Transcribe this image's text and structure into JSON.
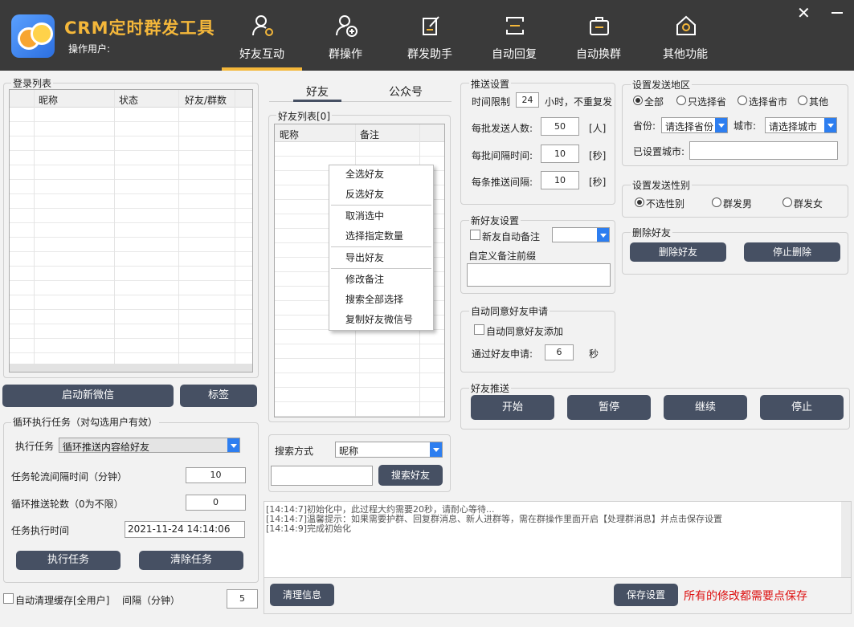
{
  "app": {
    "title": "CRM定时群发工具",
    "operator_label": "操作用户:",
    "accent_color": "#f4b73a",
    "header_color": "#3a3a3a"
  },
  "nav": [
    {
      "label": "好友互动",
      "icon": "user-gear-icon",
      "active": true
    },
    {
      "label": "群操作",
      "icon": "user-plus-icon",
      "active": false
    },
    {
      "label": "群发助手",
      "icon": "edit-doc-icon",
      "active": false
    },
    {
      "label": "自动回复",
      "icon": "auto-reply-icon",
      "active": false
    },
    {
      "label": "自动换群",
      "icon": "briefcase-icon",
      "active": false
    },
    {
      "label": "其他功能",
      "icon": "home-gear-icon",
      "active": false
    }
  ],
  "login_list": {
    "title": "登录列表",
    "columns": [
      "昵称",
      "状态",
      "好友/群数"
    ]
  },
  "left_buttons": {
    "start_wechat": "启动新微信",
    "tag": "标签"
  },
  "loop_task": {
    "title": "循环执行任务（对勾选用户有效）",
    "task_label": "执行任务",
    "task_value": "循环推送内容给好友",
    "interval_label": "任务轮流间隔时间（分钟）",
    "interval_value": "10",
    "rounds_label": "循环推送轮数（0为不限）",
    "rounds_value": "0",
    "time_label": "任务执行时间",
    "time_value": "2021-11-24 14:14:06",
    "exec_button": "执行任务",
    "clear_button": "清除任务"
  },
  "auto_clear": {
    "label": "自动清理缓存[全用户]",
    "interval_label": "间隔（分钟）",
    "interval_value": "5"
  },
  "tabs": {
    "friends": "好友",
    "public": "公众号"
  },
  "friend_list": {
    "title": "好友列表[0]",
    "columns": [
      "昵称",
      "备注"
    ]
  },
  "context_menu": [
    "全选好友",
    "反选好友",
    "取消选中",
    "选择指定数量",
    "导出好友",
    "修改备注",
    "搜索全部选择",
    "复制好友微信号"
  ],
  "search": {
    "label": "搜索方式",
    "mode": "昵称",
    "input_value": "",
    "button": "搜索好友"
  },
  "push_settings": {
    "title": "推送设置",
    "time_limit_label": "时间限制",
    "time_limit_value": "24",
    "time_limit_suffix": "小时，不重复发",
    "batch_label": "每批发送人数:",
    "batch_value": "50",
    "batch_unit": "[人]",
    "batch_interval_label": "每批间隔时间:",
    "batch_interval_value": "10",
    "batch_interval_unit": "[秒]",
    "each_interval_label": "每条推送间隔:",
    "each_interval_value": "10",
    "each_interval_unit": "[秒]"
  },
  "new_friend": {
    "title": "新好友设置",
    "auto_remark_label": "新友自动备注",
    "prefix_label": "自定义备注前缀",
    "prefix_value": ""
  },
  "auto_accept": {
    "title": "自动同意好友申请",
    "checkbox_label": "自动同意好友添加",
    "pass_label": "通过好友申请:",
    "pass_value": "6",
    "pass_unit": "秒"
  },
  "region": {
    "title": "设置发送地区",
    "options": [
      "全部",
      "只选择省",
      "选择省市",
      "其他"
    ],
    "selected": 0,
    "province_label": "省份:",
    "province_value": "请选择省份",
    "city_label": "城市:",
    "city_value": "请选择城市",
    "set_city_label": "已设置城市:",
    "set_city_value": ""
  },
  "gender": {
    "title": "设置发送性别",
    "options": [
      "不选性别",
      "群发男",
      "群发女"
    ],
    "selected": 0
  },
  "delete_friend": {
    "title": "删除好友",
    "delete_button": "删除好友",
    "stop_button": "停止删除"
  },
  "friend_push": {
    "title": "好友推送",
    "buttons": [
      "开始",
      "暂停",
      "继续",
      "停止"
    ]
  },
  "log": [
    "[14:14:7]初始化中，此过程大约需要20秒，请耐心等待...",
    "[14:14:7]温馨提示：如果需要护群、回复群消息、新人进群等，需在群操作里面开启【处理群消息】并点击保存设置",
    "[14:14:9]完成初始化"
  ],
  "bottom": {
    "clear_button": "清理信息",
    "save_button": "保存设置",
    "save_note": "所有的修改都需要点保存",
    "note_color": "#dd1111"
  }
}
